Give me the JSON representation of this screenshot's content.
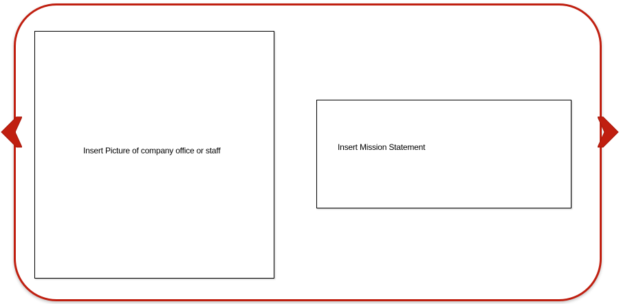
{
  "slide": {
    "picture_placeholder": "Insert Picture of company office or staff",
    "mission_placeholder": "Insert Mission Statement"
  },
  "navigation": {
    "prev_icon": "chevron-left-icon",
    "next_icon": "chevron-right-icon"
  },
  "colors": {
    "accent": "#c01f10",
    "border": "#000000",
    "background": "#ffffff"
  }
}
